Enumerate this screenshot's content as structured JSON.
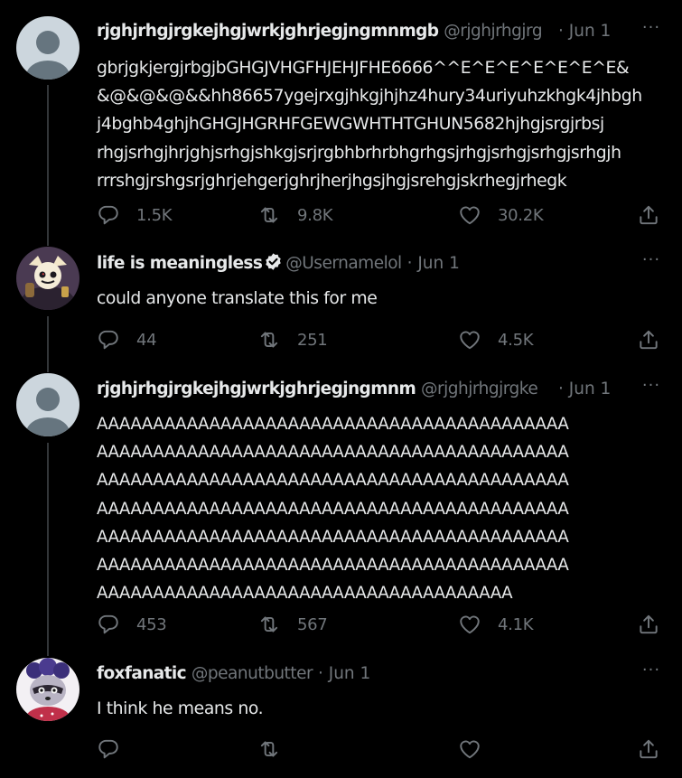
{
  "tweets": [
    {
      "name": "rjghjrhgjrgkejhgjwrkjghrjegjngmnmgb",
      "handle": "@rjghjrhgjrg",
      "date": "Jun 1",
      "text": "gbrjgkjergjrbgjbGHGJVHGFHJEHJFHE6666^^E^E^E^E^E^E^E&\n&@&@&@&&hh86657ygejrxgjhkgjhjhz4hury34uriyuhzkhgk4jhbgh\nj4bghb4ghjhGHGJHGRHFGEWGWHTHTGHUN5682hjhgjsrgjrbsj\nrhgjsrhgjhrjghjsrhgjshkgjsrjrgbhbrhrbhgrhgsjrhgjsrhgjsrhgjsrhgjh\nrrrshgjrshgsrjghrjehgerjghrjherjhgsjhgjsrehgjskrhegjrhegk",
      "replies": "1.5K",
      "retweets": "9.8K",
      "likes": "30.2K"
    },
    {
      "name": "life is meaningless",
      "handle": "@Usernamelol",
      "date": "Jun 1",
      "text": "could anyone translate this for me",
      "replies": "44",
      "retweets": "251",
      "likes": "4.5K"
    },
    {
      "name": "rjghjrhgjrgkejhgjwrkjghrjegjngmnm",
      "handle": "@rjghjrhgjrgke",
      "date": "Jun 1",
      "text": "AAAAAAAAAAAAAAAAAAAAAAAAAAAAAAAAAAAAAAAAAA\nAAAAAAAAAAAAAAAAAAAAAAAAAAAAAAAAAAAAAAAAAA\nAAAAAAAAAAAAAAAAAAAAAAAAAAAAAAAAAAAAAAAAAA\nAAAAAAAAAAAAAAAAAAAAAAAAAAAAAAAAAAAAAAAAAA\nAAAAAAAAAAAAAAAAAAAAAAAAAAAAAAAAAAAAAAAAAA\nAAAAAAAAAAAAAAAAAAAAAAAAAAAAAAAAAAAAAAAAAA\nAAAAAAAAAAAAAAAAAAAAAAAAAAAAAAAAAAAAA",
      "replies": "453",
      "retweets": "567",
      "likes": "4.1K"
    },
    {
      "name": "foxfanatic",
      "handle": "@peanutbutter",
      "date": "Jun 1",
      "text": "I think he means no.",
      "replies": "",
      "retweets": "",
      "likes": ""
    }
  ],
  "more_label": "···",
  "colors": {
    "background": "#000000",
    "text": "#e7e9ea",
    "secondary": "#71767b",
    "thread_line": "#333639",
    "default_avatar_bg": "#ccd6dd",
    "default_avatar_fg": "#66757f"
  },
  "icons": {
    "reply": "reply-icon",
    "retweet": "retweet-icon",
    "like": "like-icon",
    "share": "share-icon",
    "verified": "verified-badge-icon",
    "more": "more-icon"
  }
}
